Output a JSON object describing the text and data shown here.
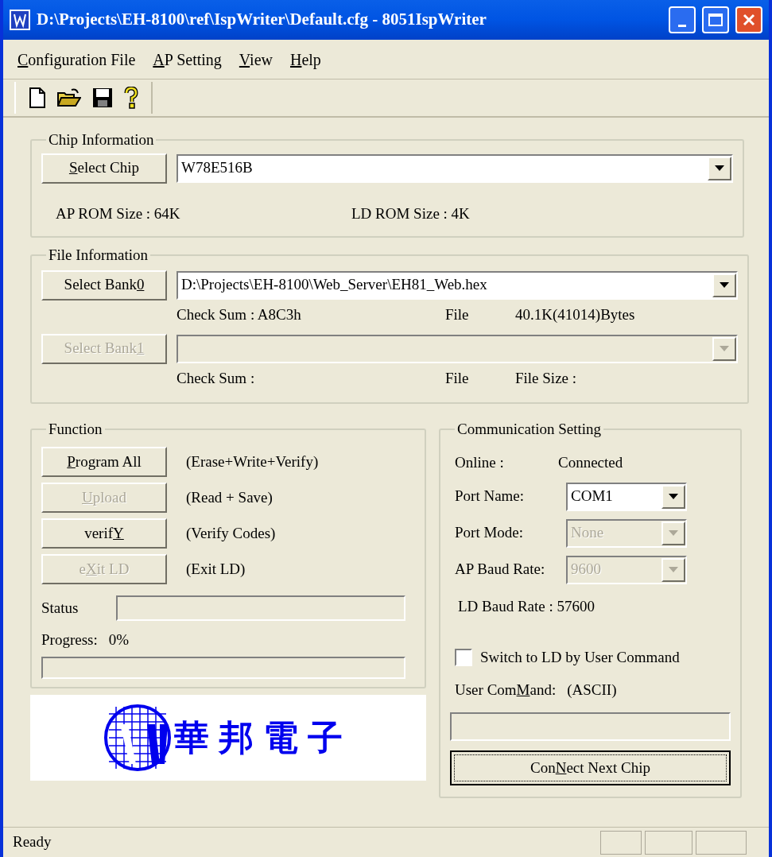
{
  "window": {
    "title": "D:\\Projects\\EH-8100\\ref\\IspWriter\\Default.cfg - 8051IspWriter"
  },
  "menu": [
    {
      "label": [
        {
          "text": "C",
          "underlined": true
        },
        {
          "text": "onfiguration File",
          "underlined": false
        }
      ]
    },
    {
      "label": [
        {
          "text": "A",
          "underlined": true
        },
        {
          "text": "P Setting",
          "underlined": false
        }
      ]
    },
    {
      "label": [
        {
          "text": "V",
          "underlined": true
        },
        {
          "text": "iew",
          "underlined": false
        }
      ]
    },
    {
      "label": [
        {
          "text": "H",
          "underlined": true
        },
        {
          "text": "elp",
          "underlined": false
        }
      ]
    }
  ],
  "toolbar": [
    {
      "kind": "new"
    },
    {
      "kind": "open"
    },
    {
      "kind": "save"
    },
    {
      "kind": "help"
    }
  ],
  "chip_info": {
    "title": "Chip Information",
    "button": {
      "label": [
        {
          "text": "S",
          "underlined": true
        },
        {
          "text": "elect Chip",
          "underlined": false
        }
      ],
      "disabled": false
    },
    "combo": {
      "value": "W78E516B",
      "disabled": false
    },
    "ap_rom": "AP ROM Size : 64K",
    "ld_rom": "LD ROM Size : 4K"
  },
  "file_info": {
    "title": "File Information",
    "banks": [
      {
        "button": {
          "label": [
            {
              "text": "Select Bank",
              "underlined": false
            },
            {
              "text": "0",
              "underlined": true
            }
          ],
          "disabled": false
        },
        "combo": {
          "value": "D:\\Projects\\EH-8100\\Web_Server\\EH81_Web.hex",
          "disabled": false
        },
        "checksum": "Check Sum : A8C3h",
        "file_label": "File",
        "size": "40.1K(41014)Bytes"
      },
      {
        "button": {
          "label": [
            {
              "text": "Select Bank",
              "underlined": false
            },
            {
              "text": "1",
              "underlined": true
            }
          ],
          "disabled": true
        },
        "combo": {
          "disabled": true
        },
        "checksum": "Check Sum :",
        "file_label": "File",
        "size": "File Size :"
      }
    ]
  },
  "function": {
    "title": "Function",
    "actions": [
      {
        "label": [
          {
            "text": "P",
            "underlined": true
          },
          {
            "text": "rogram All",
            "underlined": false
          }
        ],
        "disabled": false,
        "note": "(Erase+Write+Verify)"
      },
      {
        "label": [
          {
            "text": "U",
            "underlined": true
          },
          {
            "text": "pload",
            "underlined": false
          }
        ],
        "disabled": true,
        "note": "(Read + Save)"
      },
      {
        "label": [
          {
            "text": "verif",
            "underlined": false
          },
          {
            "text": "Y",
            "underlined": true
          }
        ],
        "disabled": false,
        "note": "(Verify Codes)"
      },
      {
        "label": [
          {
            "text": "e",
            "underlined": false
          },
          {
            "text": "X",
            "underlined": true
          },
          {
            "text": "it LD",
            "underlined": false
          }
        ],
        "disabled": true,
        "note": "(Exit LD)"
      }
    ],
    "status_label": "Status",
    "progress_label": "Progress:",
    "progress_value": "0%",
    "progress": {
      "level": 0
    }
  },
  "logo": {
    "text": "華邦電子"
  },
  "comm": {
    "title": "Communication Setting",
    "online_label": "Online :",
    "online_value": "Connected",
    "fields": [
      {
        "label": "Port Name:",
        "value": "COM1",
        "disabled": false
      },
      {
        "label": "Port Mode:",
        "value": "None",
        "disabled": true
      },
      {
        "label": "AP Baud Rate:",
        "value": "9600",
        "disabled": true
      }
    ],
    "ld_baud": "LD Baud Rate : 57600",
    "switch": {
      "label": "Switch to LD by User Command",
      "checked": false
    },
    "user_command": {
      "label": [
        {
          "text": "User Com",
          "underlined": false
        },
        {
          "text": "M",
          "underlined": true
        },
        {
          "text": "and:",
          "underlined": false
        }
      ],
      "hint": "(ASCII)"
    },
    "connect_button": {
      "label": [
        {
          "text": "Con",
          "underlined": false
        },
        {
          "text": "N",
          "underlined": true
        },
        {
          "text": "ect Next Chip",
          "underlined": false
        }
      ],
      "focused": true
    }
  },
  "status_bar": {
    "text": "Ready"
  }
}
